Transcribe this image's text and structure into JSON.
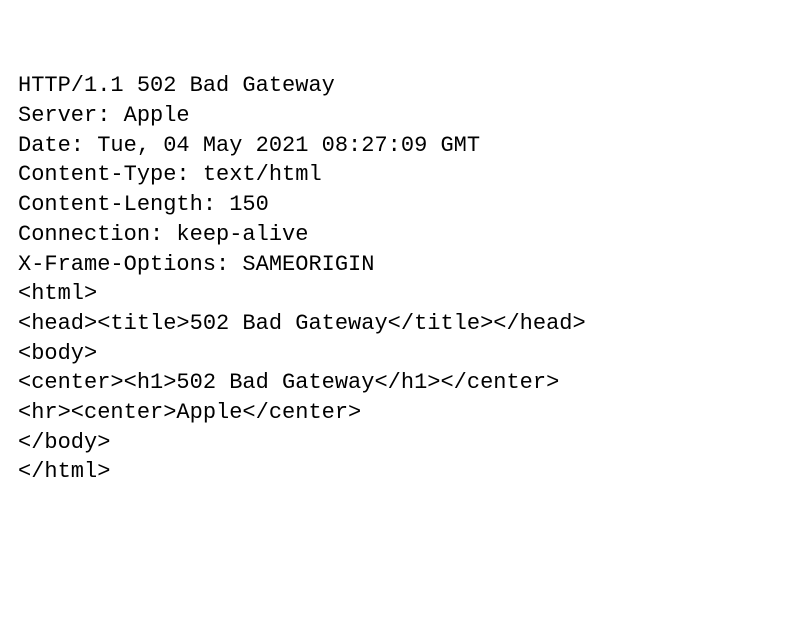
{
  "lines": {
    "l0": "HTTP/1.1 502 Bad Gateway",
    "l1": "Server: Apple",
    "l2": "Date: Tue, 04 May 2021 08:27:09 GMT",
    "l3": "Content-Type: text/html",
    "l4": "Content-Length: 150",
    "l5": "Connection: keep-alive",
    "l6": "X-Frame-Options: SAMEORIGIN",
    "l7": "",
    "l8": "<html>",
    "l9": "<head><title>502 Bad Gateway</title></head>",
    "l10": "<body>",
    "l11": "<center><h1>502 Bad Gateway</h1></center>",
    "l12": "<hr><center>Apple</center>",
    "l13": "</body>",
    "l14": "</html>"
  }
}
